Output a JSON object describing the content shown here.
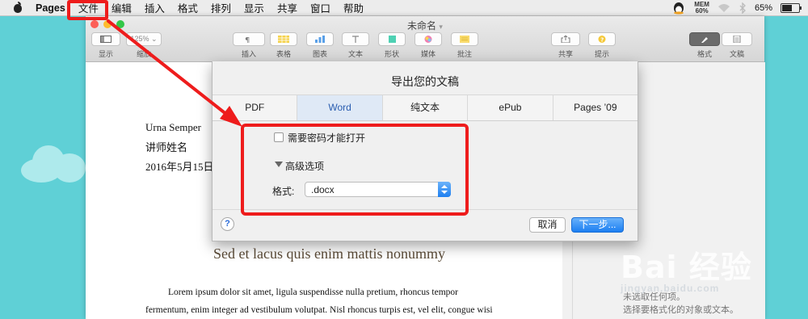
{
  "menubar": {
    "app_name": "Pages",
    "items": [
      "文件",
      "编辑",
      "插入",
      "格式",
      "排列",
      "显示",
      "共享",
      "窗口",
      "帮助"
    ],
    "mem_label": "MEM",
    "mem_value": "60%",
    "battery_percent": "65%",
    "battery_level": 0.65
  },
  "window": {
    "title": "未命名",
    "toolbar": {
      "view_label": "显示",
      "zoom_value": "125%",
      "zoom_label": "缩放",
      "insert_label": "插入",
      "table_label": "表格",
      "chart_label": "图表",
      "text_label": "文本",
      "shape_label": "形状",
      "media_label": "媒体",
      "comment_label": "批注",
      "share_label": "共享",
      "tips_label": "提示",
      "format_label": "格式",
      "document_label": "文稿"
    },
    "colors": {
      "close": "#fc5f57",
      "minimize": "#fdbc2e",
      "zoom": "#33c748"
    }
  },
  "document": {
    "author": "Urna Semper",
    "instructor": "讲师姓名",
    "date": "2016年5月15日",
    "heading": "Sed et lacus quis enim mattis nonummy",
    "body_line1": "Lorem ipsum dolor sit amet, ligula suspendisse nulla pretium, rhoncus tempor",
    "body_line2": "fermentum, enim integer ad vestibulum volutpat. Nisl rhoncus turpis est, vel elit, congue wisi"
  },
  "sidebar": {
    "line1": "未选取任何项。",
    "line2": "选择要格式化的对象或文本。"
  },
  "export_dialog": {
    "title": "导出您的文稿",
    "tabs": [
      "PDF",
      "Word",
      "纯文本",
      "ePub",
      "Pages ’09"
    ],
    "selected_tab": "Word",
    "password_label": "需要密码才能打开",
    "password_checked": false,
    "advanced_label": "高级选项",
    "format_label": "格式:",
    "format_value": ".docx",
    "help_label": "?",
    "cancel_label": "取消",
    "next_label": "下一步..."
  },
  "watermark": {
    "main": "Bai 经验",
    "sub": "jingyan.baidu.com"
  },
  "annotation_color": "#ee1c1c"
}
